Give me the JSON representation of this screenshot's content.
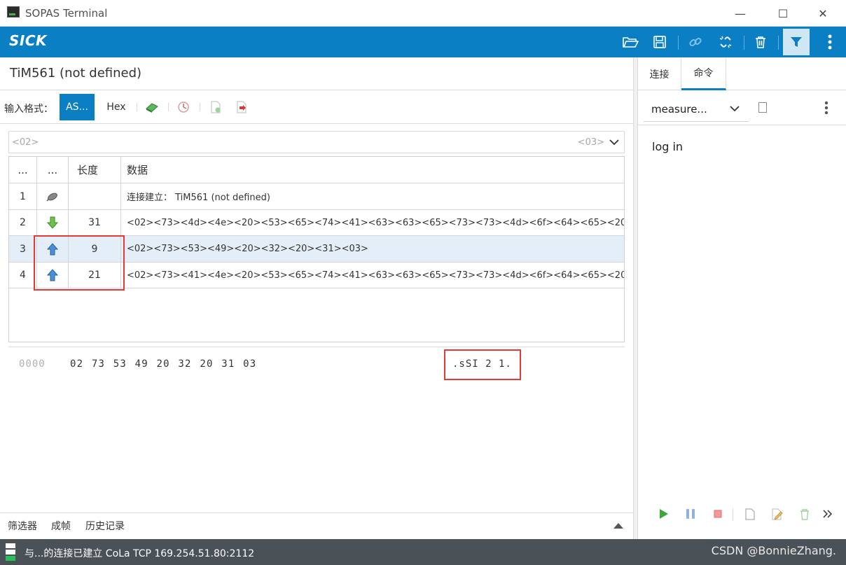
{
  "window": {
    "title": "SOPAS Terminal",
    "minimize": "—",
    "maximize": "☐",
    "close": "✕"
  },
  "toolbar": {
    "brand": "SICK",
    "icons": [
      "folder-open-icon",
      "save-icon",
      "link-icon",
      "unlink-icon",
      "trash-icon",
      "filter-icon",
      "more-vertical-icon"
    ],
    "accent": "#0a7fc4"
  },
  "device": {
    "title": "TiM561 (not defined)"
  },
  "input_format": {
    "label": "输入格式：",
    "ascii_label": "AS...",
    "hex_label": "Hex",
    "input_prefix": "<02>",
    "input_suffix": "<03>"
  },
  "table": {
    "headers": [
      "...",
      "...",
      "长度",
      "数据"
    ],
    "rows": [
      {
        "index": "1",
        "direction": "connect",
        "length": "",
        "data": "连接建立： TiM561 (not defined)"
      },
      {
        "index": "2",
        "direction": "down",
        "length": "31",
        "data": "<02><73><4d><4e><20><53><65><74><41><63><63><65><73><73><4d><6f><64><65><20>..."
      },
      {
        "index": "3",
        "direction": "up",
        "length": "9",
        "data": "<02><73><53><49><20><32><20><31><03>"
      },
      {
        "index": "4",
        "direction": "up",
        "length": "21",
        "data": "<02><73><41><4e><20><53><65><74><41><63><63><65><73><73><4d><6f><64><65><20>..."
      }
    ]
  },
  "hex_view": {
    "offset": "0000",
    "bytes": "02 73 53 49 20 32 20 31 03",
    "ascii": ".sSI 2 1."
  },
  "bottom_tabs": [
    "筛选器",
    "成帧",
    "历史记录"
  ],
  "right_pane": {
    "tabs": [
      "连接",
      "命令"
    ],
    "active_tab": "命令",
    "command_select": "measure...",
    "command_text": "log in"
  },
  "status": {
    "text": "与...的连接已建立 CoLa TCP 169.254.51.80:2112",
    "watermark": "CSDN @BonnieZhang."
  }
}
